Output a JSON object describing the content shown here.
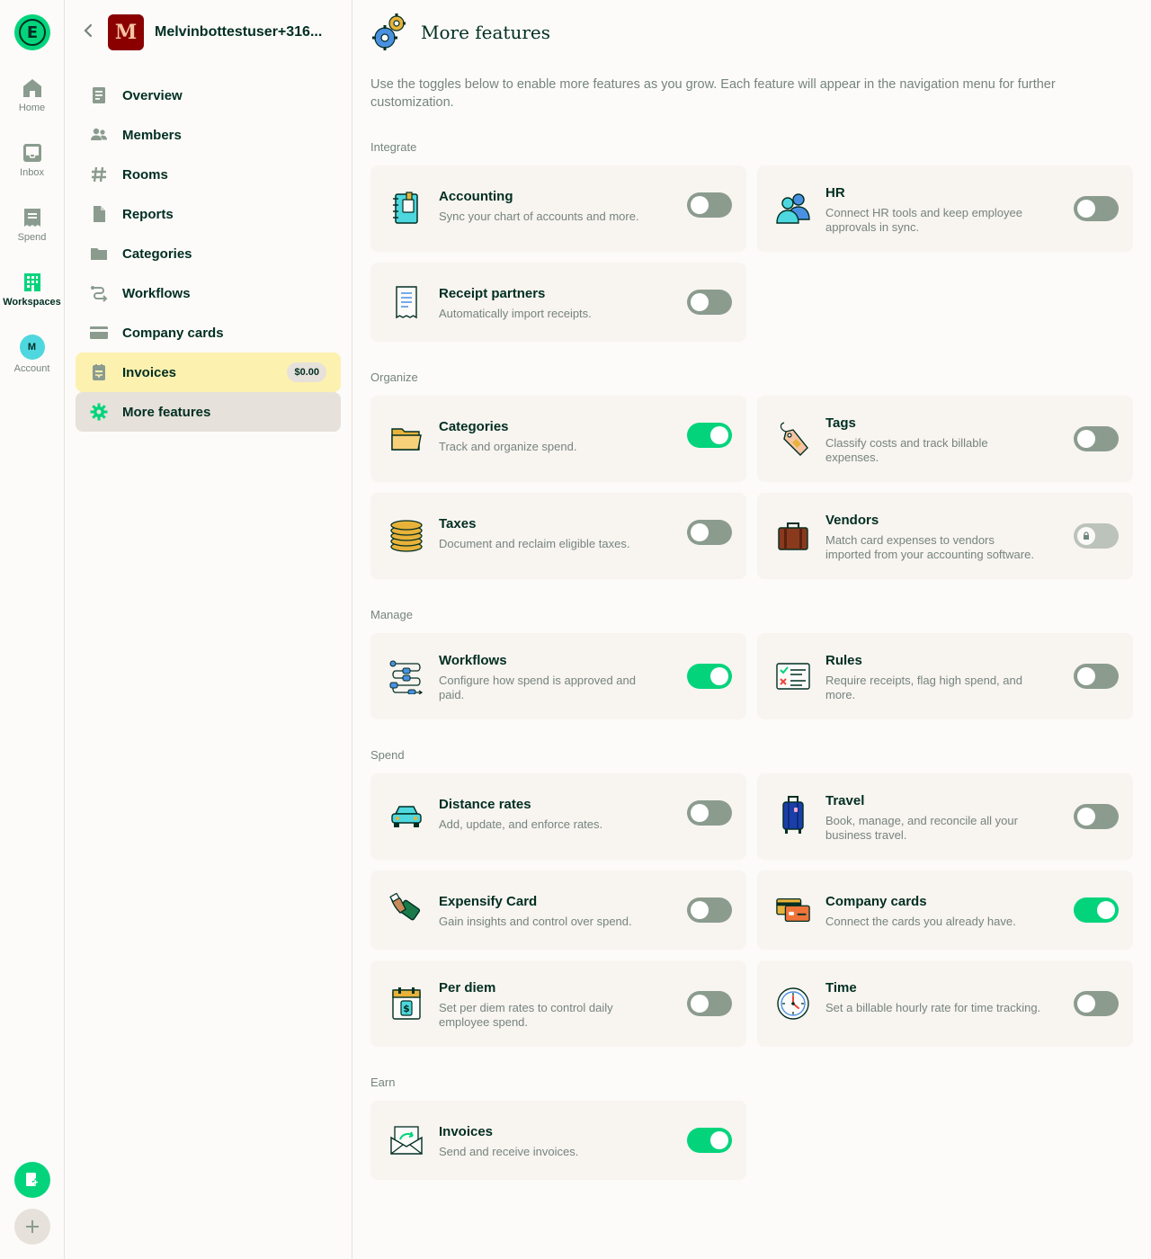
{
  "rail": {
    "logo_letter": "E",
    "items": [
      {
        "label": "Home",
        "icon": "home-icon"
      },
      {
        "label": "Inbox",
        "icon": "inbox-icon"
      },
      {
        "label": "Spend",
        "icon": "receipt-icon"
      },
      {
        "label": "Workspaces",
        "icon": "building-icon"
      },
      {
        "label": "Account",
        "icon": "avatar",
        "initial": "M"
      }
    ],
    "active_item": "Workspaces"
  },
  "sidebar": {
    "workspace_initial": "M",
    "workspace_name": "Melvinbottestuser+316...",
    "items": [
      {
        "label": "Overview",
        "icon": "document-icon"
      },
      {
        "label": "Members",
        "icon": "users-icon"
      },
      {
        "label": "Rooms",
        "icon": "hashtag-icon"
      },
      {
        "label": "Reports",
        "icon": "file-icon"
      },
      {
        "label": "Categories",
        "icon": "folder-icon"
      },
      {
        "label": "Workflows",
        "icon": "workflow-icon"
      },
      {
        "label": "Company cards",
        "icon": "credit-card-icon"
      },
      {
        "label": "Invoices",
        "icon": "invoice-icon",
        "badge": "$0.00",
        "highlighted": true
      },
      {
        "label": "More features",
        "icon": "gear-icon",
        "selected": true
      }
    ]
  },
  "main": {
    "title": "More features",
    "intro": "Use the toggles below to enable more features as you grow. Each feature will appear in the navigation menu for further customization.",
    "sections": {
      "integrate": "Integrate",
      "organize": "Organize",
      "manage": "Manage",
      "spend": "Spend",
      "earn": "Earn"
    },
    "features": {
      "accounting": {
        "title": "Accounting",
        "desc": "Sync your chart of accounts and more.",
        "enabled": false
      },
      "hr": {
        "title": "HR",
        "desc": "Connect HR tools and keep employee approvals in sync.",
        "enabled": false
      },
      "receipt_partners": {
        "title": "Receipt partners",
        "desc": "Automatically import receipts.",
        "enabled": false
      },
      "categories": {
        "title": "Categories",
        "desc": "Track and organize spend.",
        "enabled": true
      },
      "tags": {
        "title": "Tags",
        "desc": "Classify costs and track billable expenses.",
        "enabled": false
      },
      "taxes": {
        "title": "Taxes",
        "desc": "Document and reclaim eligible taxes.",
        "enabled": false
      },
      "vendors": {
        "title": "Vendors",
        "desc": "Match card expenses to vendors imported from your accounting software.",
        "enabled": false,
        "locked": true
      },
      "workflows": {
        "title": "Workflows",
        "desc": "Configure how spend is approved and paid.",
        "enabled": true
      },
      "rules": {
        "title": "Rules",
        "desc": "Require receipts, flag high spend, and more.",
        "enabled": false
      },
      "distance_rates": {
        "title": "Distance rates",
        "desc": "Add, update, and enforce rates.",
        "enabled": false
      },
      "travel": {
        "title": "Travel",
        "desc": "Book, manage, and reconcile all your business travel.",
        "enabled": false
      },
      "expensify_card": {
        "title": "Expensify Card",
        "desc": "Gain insights and control over spend.",
        "enabled": false
      },
      "company_cards": {
        "title": "Company cards",
        "desc": "Connect the cards you already have.",
        "enabled": true
      },
      "per_diem": {
        "title": "Per diem",
        "desc": "Set per diem rates to control daily employee spend.",
        "enabled": false
      },
      "time": {
        "title": "Time",
        "desc": "Set a billable hourly rate for time tracking.",
        "enabled": false
      },
      "invoices": {
        "title": "Invoices",
        "desc": "Send and receive invoices.",
        "enabled": true
      }
    }
  },
  "colors": {
    "accent_green": "#03D47C",
    "text_dark": "#002E22",
    "text_muted": "#76847E",
    "card_bg": "#F8F4F0",
    "toggle_off": "#8B9C8F",
    "highlight_yellow": "#FDF1AF",
    "selected_bg": "#E6E1DA"
  }
}
